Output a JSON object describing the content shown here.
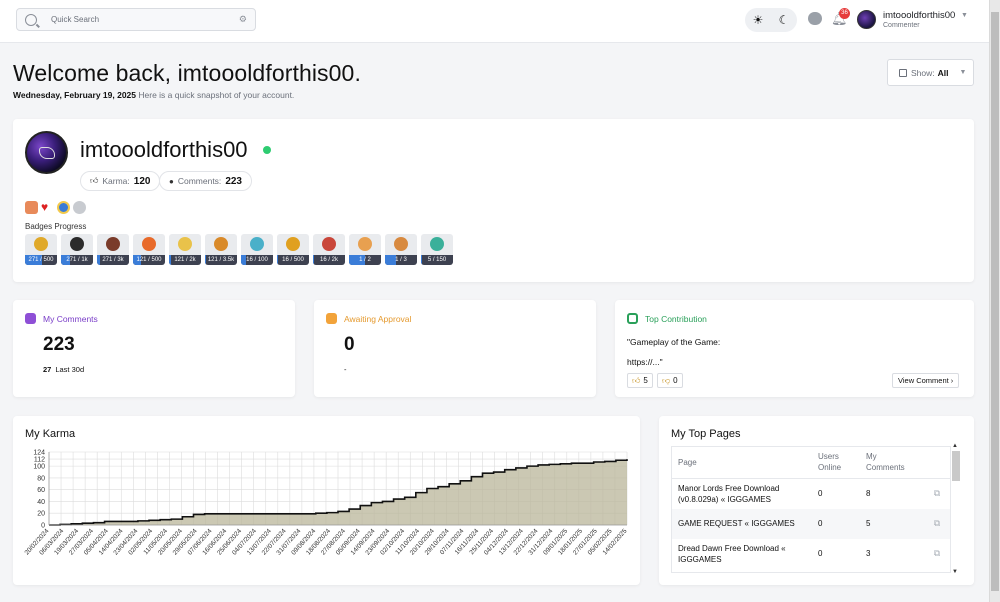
{
  "topbar": {
    "search_placeholder": "Quick Search",
    "notification_count": "36",
    "user_name": "imtoooldforthis00",
    "user_role": "Commenter"
  },
  "header": {
    "welcome": "Welcome back, imtoooldforthis00.",
    "date": "Wednesday, February 19, 2025",
    "subtitle": "Here is a quick snapshot of your account.",
    "show_label": "Show:",
    "show_value": "All"
  },
  "profile": {
    "username": "imtoooldforthis00",
    "karma_label": "Karma:",
    "karma_value": "120",
    "comments_label": "Comments:",
    "comments_value": "223",
    "badges_label": "Badges Progress",
    "badges": [
      {
        "icon": "medal-icon",
        "color": "#e0a92a",
        "text": "271 / 500",
        "progress": 0.542
      },
      {
        "icon": "tie-icon",
        "color": "#2b2b2b",
        "text": "271 / 1k",
        "progress": 0.271
      },
      {
        "icon": "ball-icon",
        "color": "#7a3b2a",
        "text": "271 / 3k",
        "progress": 0.09
      },
      {
        "icon": "heart-icon",
        "color": "#e86a2a",
        "text": "121 / 500",
        "progress": 0.242
      },
      {
        "icon": "sunglasses-icon",
        "color": "#e9c24a",
        "text": "121 / 2k",
        "progress": 0.06
      },
      {
        "icon": "sun-badge-icon",
        "color": "#d98a2a",
        "text": "121 / 3.5k",
        "progress": 0.035
      },
      {
        "icon": "chat-badge-icon",
        "color": "#4ab0c9",
        "text": "16 / 100",
        "progress": 0.16
      },
      {
        "icon": "paw-icon",
        "color": "#e0a020",
        "text": "16 / 500",
        "progress": 0.032
      },
      {
        "icon": "group-icon",
        "color": "#c9463a",
        "text": "16 / 2k",
        "progress": 0.008
      },
      {
        "icon": "trophy-icon",
        "color": "#e8a050",
        "text": "1 / 2",
        "progress": 0.5
      },
      {
        "icon": "crown-icon",
        "color": "#d88a40",
        "text": "1 / 3",
        "progress": 0.333
      },
      {
        "icon": "bulb-icon",
        "color": "#3ab09a",
        "text": "5 / 150",
        "progress": 0.033
      }
    ]
  },
  "stats": {
    "comments": {
      "title": "My Comments",
      "value": "223",
      "recent_value": "27",
      "recent_label": "Last 30d"
    },
    "awaiting": {
      "title": "Awaiting Approval",
      "value": "0",
      "sub": "-"
    },
    "top": {
      "title": "Top Contribution",
      "quote_line1": "\"Gameplay of the Game:",
      "quote_line2": "https://...\"",
      "up": "5",
      "down": "0",
      "view_label": "View Comment ›"
    }
  },
  "karma_title": "My Karma",
  "chart_data": {
    "type": "area",
    "title": "My Karma",
    "ylim": [
      0,
      124
    ],
    "yticks": [
      0,
      20,
      40,
      60,
      80,
      100,
      112,
      124
    ],
    "x": [
      "20/02/2024",
      "27/02/2024",
      "05/03/2024",
      "12/03/2024",
      "19/03/2024",
      "26/03/2024",
      "02/04/2024",
      "09/04/2024",
      "16/04/2024",
      "23/04/2024",
      "30/04/2024",
      "07/05/2024",
      "14/05/2024",
      "21/05/2024",
      "28/05/2024",
      "04/06/2024",
      "11/06/2024",
      "18/06/2024",
      "25/06/2024",
      "02/07/2024",
      "09/07/2024",
      "16/07/2024",
      "23/07/2024",
      "30/07/2024",
      "06/08/2024",
      "13/08/2024",
      "20/08/2024",
      "27/08/2024",
      "03/09/2024",
      "10/09/2024",
      "17/09/2024",
      "24/09/2024",
      "01/10/2024",
      "08/10/2024",
      "15/10/2024",
      "22/10/2024",
      "29/10/2024",
      "05/11/2024",
      "12/11/2024",
      "19/11/2024",
      "26/11/2024",
      "03/12/2024",
      "10/12/2024",
      "17/12/2024",
      "24/12/2024",
      "31/12/2024",
      "07/01/2025",
      "14/01/2025",
      "21/01/2025",
      "28/01/2025",
      "04/02/2025",
      "11/02/2025",
      "18/02/2025"
    ],
    "xtick_labels": [
      "20/02/2024",
      "06/03/2024",
      "19/03/2024",
      "27/03/2024",
      "05/04/2024",
      "14/04/2024",
      "23/04/2024",
      "02/05/2024",
      "11/05/2024",
      "20/05/2024",
      "29/05/2024",
      "07/06/2024",
      "16/06/2024",
      "25/06/2024",
      "04/07/2024",
      "13/07/2024",
      "22/07/2024",
      "31/07/2024",
      "09/08/2024",
      "18/08/2024",
      "27/08/2024",
      "05/09/2024",
      "14/09/2024",
      "23/09/2024",
      "02/10/2024",
      "11/10/2024",
      "20/10/2024",
      "29/10/2024",
      "07/11/2024",
      "16/11/2024",
      "25/11/2024",
      "04/12/2024",
      "13/12/2024",
      "22/12/2024",
      "31/12/2024",
      "09/01/2025",
      "18/01/2025",
      "27/01/2025",
      "05/02/2025",
      "14/02/2025"
    ],
    "values": [
      0,
      1,
      2,
      3,
      4,
      6,
      6,
      6,
      7,
      8,
      9,
      10,
      14,
      18,
      19,
      19,
      19,
      19,
      19,
      19,
      19,
      19,
      19,
      19,
      20,
      21,
      23,
      27,
      33,
      38,
      40,
      44,
      47,
      55,
      62,
      65,
      70,
      75,
      82,
      88,
      90,
      94,
      97,
      100,
      102,
      103,
      104,
      105,
      105,
      107,
      108,
      110,
      112
    ],
    "grid": true,
    "legend": false
  },
  "pages": {
    "title": "My Top Pages",
    "columns": [
      "Page",
      "Users Online",
      "My Comments"
    ],
    "rows": [
      {
        "page": "Manor Lords Free Download (v0.8.029a) « IGGGAMES",
        "online": "0",
        "comments": "8"
      },
      {
        "page": "GAME REQUEST « IGGGAMES",
        "online": "0",
        "comments": "5"
      },
      {
        "page": "Dread Dawn Free Download « IGGGAMES",
        "online": "0",
        "comments": "3"
      }
    ]
  }
}
